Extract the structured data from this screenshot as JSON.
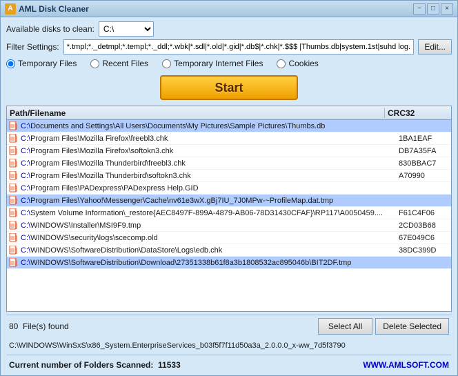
{
  "window": {
    "title": "AML Disk Cleaner",
    "minimize_label": "−",
    "maximize_label": "□",
    "close_label": "×"
  },
  "toolbar": {
    "available_disks_label": "Available disks to clean:",
    "disk_value": "C:\\",
    "filter_label": "Filter Settings:",
    "filter_value": "*.tmpl;*._detmpl;*.templ;*._ddl;*.wbk|*.sdl|*.old|*.gid|*.db$|*.chk|*.$$$ |Thumbs.db|system.1st|suhd log.dat|...",
    "edit_label": "Edit..."
  },
  "radio_group": {
    "options": [
      {
        "id": "r1",
        "label": "Temporary Files",
        "checked": true
      },
      {
        "id": "r2",
        "label": "Recent Files",
        "checked": false
      },
      {
        "id": "r3",
        "label": "Temporary Internet Files",
        "checked": false
      },
      {
        "id": "r4",
        "label": "Cookies",
        "checked": false
      }
    ]
  },
  "start_button": "Start",
  "list": {
    "col_path": "Path/Filename",
    "col_crc": "CRC32",
    "files": [
      {
        "path": "C:\\Documents and Settings\\All Users\\Documents\\My Pictures\\Sample Pictures\\Thumbs.db",
        "crc": "",
        "highlight": true
      },
      {
        "path": "C:\\Program Files\\Mozilla Firefox\\freebl3.chk",
        "crc": "1BA1EAF",
        "highlight": false
      },
      {
        "path": "C:\\Program Files\\Mozilla Firefox\\softokn3.chk",
        "crc": "DB7A35FA",
        "highlight": false
      },
      {
        "path": "C:\\Program Files\\Mozilla Thunderbird\\freebl3.chk",
        "crc": "830BBAC7",
        "highlight": false
      },
      {
        "path": "C:\\Program Files\\Mozilla Thunderbird\\softokn3.chk",
        "crc": "A70990",
        "highlight": false
      },
      {
        "path": "C:\\Program Files\\PADexpress\\PADexpress Help.GID",
        "crc": "",
        "highlight": false
      },
      {
        "path": "C:\\Program Files\\Yahoo!\\Messenger\\Cache\\nv61e3wX.gBj7IU_7J0MPw-~ProfileMap.dat.tmp",
        "crc": "",
        "highlight": true
      },
      {
        "path": "C:\\System Volume Information\\_restore{AEC8497F-899A-4879-AB06-78D31430CFAF}\\RP117\\A0050459....",
        "crc": "F61C4F06",
        "highlight": false
      },
      {
        "path": "C:\\WINDOWS\\Installer\\MSI9F9.tmp",
        "crc": "2CD03B68",
        "highlight": false
      },
      {
        "path": "C:\\WINDOWS\\security\\logs\\scecomp.old",
        "crc": "67E049C6",
        "highlight": false
      },
      {
        "path": "C:\\WINDOWS\\SoftwareDistribution\\DataStore\\Logs\\edb.chk",
        "crc": "38DC399D",
        "highlight": false
      },
      {
        "path": "C:\\WINDOWS\\SoftwareDistribution\\Download\\27351338b61f8a3b1808532ac895046b\\BIT2DF.tmp",
        "crc": "",
        "highlight": true
      }
    ]
  },
  "bottom": {
    "file_count": "80",
    "files_found_label": "File(s) found",
    "select_all_label": "Select All",
    "delete_selected_label": "Delete Selected"
  },
  "status": {
    "path": "C:\\WINDOWS\\WinSxS\\x86_System.EnterpriseServices_b03f5f7f11d50a3a_2.0.0.0_x-ww_7d5f3790"
  },
  "footer": {
    "folders_label": "Current number of Folders Scanned:",
    "folders_count": "11533",
    "website": "WWW.AMLSOFT.COM"
  }
}
